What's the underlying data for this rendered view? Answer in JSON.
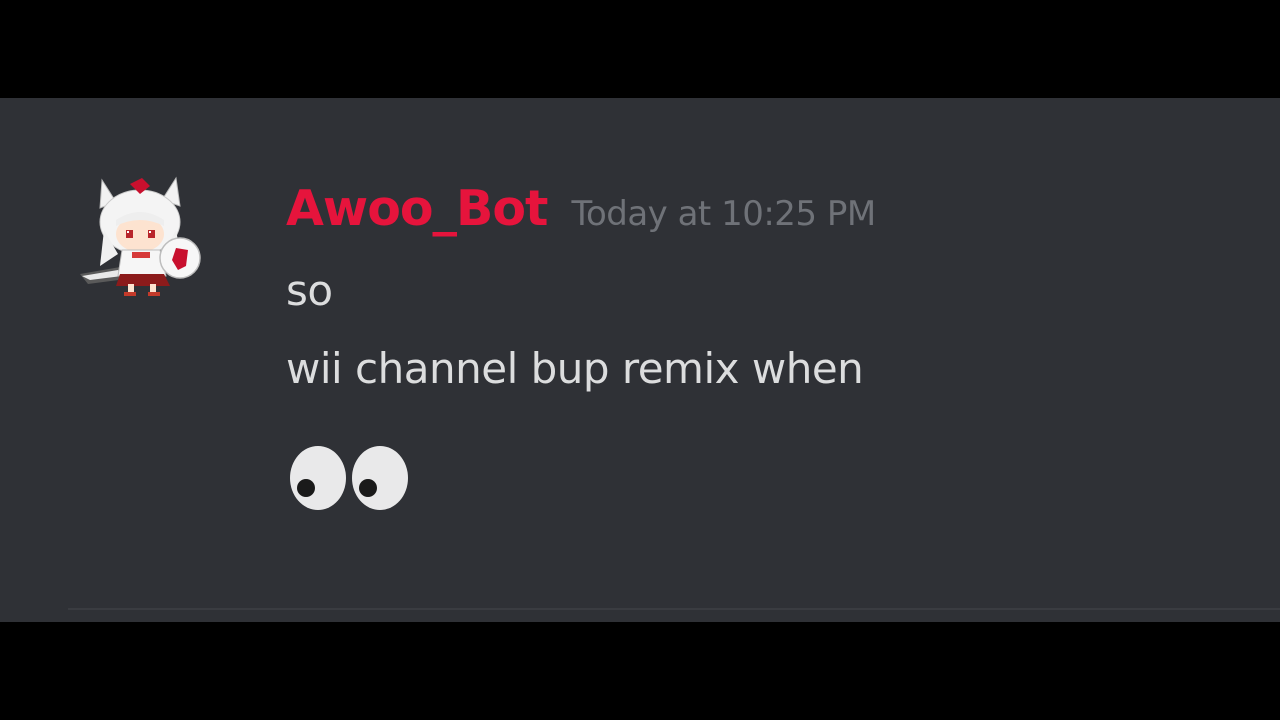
{
  "message": {
    "author": "Awoo_Bot",
    "timestamp": "Today at 10:25 PM",
    "lines": [
      "so",
      "wii channel bup remix when"
    ],
    "emoji": "eyes-emoji"
  },
  "colors": {
    "username": "#e6143c",
    "timestamp": "#6f7278",
    "message_text": "#dcddde",
    "panel_background": "#2f3136",
    "letterbox": "#000000"
  }
}
